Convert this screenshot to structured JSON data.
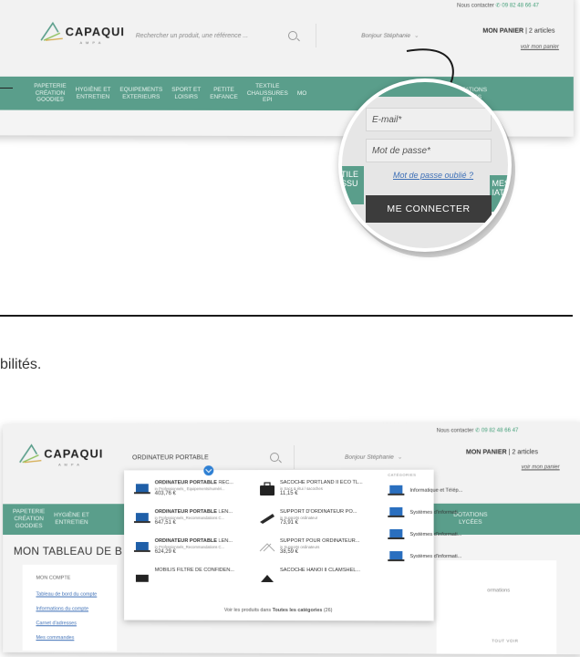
{
  "header": {
    "logo_name": "CAPAQUI",
    "logo_sub": "A M P A",
    "search_placeholder": "Rechercher un produit, une référence ...",
    "search_query": "ORDINATEUR PORTABLE",
    "greeting": "Bonjour Stéphanie",
    "contact_label": "Nous contacter",
    "phone": "09 82 48 66 47",
    "cart_title": "MON PANIER",
    "cart_count": "| 2 articles",
    "cart_link": "voir mon panier"
  },
  "nav": {
    "items": [
      [
        "PAPETERIE",
        "CRÉATION",
        "GOODIES"
      ],
      [
        "HYGIÈNE ET",
        "ENTRETIEN"
      ],
      [
        "EQUIPEMENTS",
        "EXTERIEURS"
      ],
      [
        "SPORT ET",
        "LOISIRS"
      ],
      [
        "PETITE",
        "ENFANCE"
      ],
      [
        "TEXTILE",
        "CHAUSSURES",
        "EPI"
      ],
      [
        "MO"
      ],
      [
        "ATION"
      ],
      [
        "DOTATIONS",
        "LYCÉES"
      ]
    ],
    "shot2_items": [
      [
        "PAPETERIE",
        "CRÉATION",
        "GOODIES"
      ],
      [
        "HYGIÈNE ET",
        "ENTRETIEN"
      ],
      [
        "DOTATIONS",
        "LYCÉES"
      ]
    ]
  },
  "login": {
    "email_placeholder": "E-mail*",
    "password_placeholder": "Mot de passe*",
    "forgot_link": "Mot de passe oublié ?",
    "submit_label": "ME CONNECTER",
    "left_side_text": [
      "TILE",
      "SSU",
      "I"
    ],
    "right_side_text": [
      "MES",
      "IAT"
    ]
  },
  "body_fragment": "bilités.",
  "dropdown": {
    "products": [
      {
        "name_b": "ORDINATEUR PORTABLE",
        "name_r": " REC...",
        "cat": "in Professionnels_ Equipements/numéri...",
        "price": "403,76 €"
      },
      {
        "name_b": "",
        "name_r": "SACOCHE PORTLAND II ECO TL...",
        "cat": "in Sacs & étui / sacoches",
        "price": "11,15 €"
      },
      {
        "name_b": "ORDINATEUR PORTABLE",
        "name_r": " LEN...",
        "cat": "in Professionnels_Recommandations C...",
        "price": "647,51 €"
      },
      {
        "name_b": "",
        "name_r": "SUPPORT D'ORDINATEUR PO...",
        "cat": "in Supports ordinateur",
        "price": "73,91 €"
      },
      {
        "name_b": "ORDINATEUR PORTABLE",
        "name_r": " LEN...",
        "cat": "in Professionnels_Recommandations C...",
        "price": "624,29 €"
      },
      {
        "name_b": "",
        "name_r": "SUPPORT POUR ORDINATEUR...",
        "cat": "in Supports ordinateurs",
        "price": "38,59 €"
      },
      {
        "name_b": "",
        "name_r": "MOBILIS FILTRE DE CONFIDEN...",
        "cat": "",
        "price": ""
      },
      {
        "name_b": "",
        "name_r": "SACOCHE HANOI II CLAMSHEL...",
        "cat": "",
        "price": ""
      }
    ],
    "categories_head": "CATÉGORIES",
    "categories": [
      "Informatique et Télép...",
      "Systèmes d'informati...",
      "Systèmes d'informati...",
      "Systèmes d'informati..."
    ],
    "footer_pre": "Voir les produits dans ",
    "footer_b": "Toutes les catégories",
    "footer_post": " (26)"
  },
  "dashboard": {
    "title": "MON TABLEAU DE B",
    "account_title": "MON COMPTE",
    "links": [
      "Tableau de bord du compte",
      "Informations du compte",
      "Carnet d'adresses",
      "Mes commandes"
    ],
    "right_text": "ormations",
    "tout_voir": "TOUT VOIR"
  },
  "colors": {
    "nav_green": "#5a9e8b",
    "accent_blue": "#2d7fd3",
    "link_blue": "#3d6fb6",
    "button_dark": "#3c3c3c"
  }
}
